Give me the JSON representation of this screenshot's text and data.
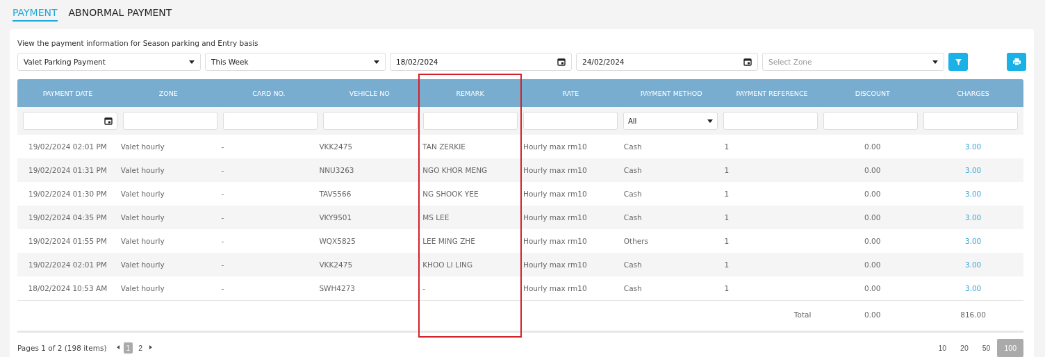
{
  "tabs": [
    {
      "label": "PAYMENT",
      "selected": true
    },
    {
      "label": "ABNORMAL PAYMENT",
      "selected": false
    }
  ],
  "description": "View the payment information for Season parking and Entry basis",
  "filters": [
    {
      "kind": "select",
      "value": "Valet Parking Payment"
    },
    {
      "kind": "select",
      "value": "This Week"
    },
    {
      "kind": "date",
      "value": "18/02/2024"
    },
    {
      "kind": "date",
      "value": "24/02/2024"
    },
    {
      "kind": "select",
      "placeholder": "Select Zone"
    }
  ],
  "table": {
    "columns": [
      {
        "label": "PAYMENT DATE",
        "highlighted": false
      },
      {
        "label": "ZONE",
        "highlighted": false
      },
      {
        "label": "CARD NO.",
        "highlighted": false
      },
      {
        "label": "VEHICLE NO",
        "highlighted": false
      },
      {
        "label": "REMARK",
        "highlighted": true
      },
      {
        "label": "RATE",
        "highlighted": false
      },
      {
        "label": "PAYMENT METHOD",
        "highlighted": false
      },
      {
        "label": "PAYMENT REFERENCE",
        "highlighted": false
      },
      {
        "label": "DISCOUNT",
        "highlighted": false
      },
      {
        "label": "CHARGES",
        "highlighted": false
      }
    ],
    "column_filters": [
      {
        "kind": "date"
      },
      {
        "kind": "text"
      },
      {
        "kind": "text"
      },
      {
        "kind": "text"
      },
      {
        "kind": "text"
      },
      {
        "kind": "text"
      },
      {
        "kind": "select",
        "value": "All"
      },
      {
        "kind": "text"
      },
      {
        "kind": "text"
      },
      {
        "kind": "text"
      }
    ],
    "rows": [
      [
        "19/02/2024 02:01 PM",
        "Valet hourly",
        "-",
        "VKK2475",
        "TAN ZERKIE",
        "Hourly max rm10",
        "Cash",
        "1",
        "0.00",
        "3.00"
      ],
      [
        "19/02/2024 01:31 PM",
        "Valet hourly",
        "-",
        "NNU3263",
        "NGO KHOR MENG",
        "Hourly max rm10",
        "Cash",
        "1",
        "0.00",
        "3.00"
      ],
      [
        "19/02/2024 01:30 PM",
        "Valet hourly",
        "-",
        "TAV5566",
        "NG SHOOK YEE",
        "Hourly max rm10",
        "Cash",
        "1",
        "0.00",
        "3.00"
      ],
      [
        "19/02/2024 04:35 PM",
        "Valet hourly",
        "-",
        "VKY9501",
        "MS LEE",
        "Hourly max rm10",
        "Cash",
        "1",
        "0.00",
        "3.00"
      ],
      [
        "19/02/2024 01:55 PM",
        "Valet hourly",
        "-",
        "WQX5825",
        "LEE MING ZHE",
        "Hourly max rm10",
        "Others",
        "1",
        "0.00",
        "3.00"
      ],
      [
        "19/02/2024 02:01 PM",
        "Valet hourly",
        "-",
        "VKK2475",
        "KHOO LI LING",
        "Hourly max rm10",
        "Cash",
        "1",
        "0.00",
        "3.00"
      ],
      [
        "18/02/2024 10:53 AM",
        "Valet hourly",
        "-",
        "SWH4273",
        "-",
        "Hourly max rm10",
        "Cash",
        "1",
        "0.00",
        "3.00"
      ]
    ],
    "totals": {
      "label": "Total",
      "discount": "0.00",
      "charges": "816.00"
    }
  },
  "pagination": {
    "summary": "Pages 1 of 2 (198 items)",
    "pages": [
      {
        "label": "1",
        "selected": true
      },
      {
        "label": "2",
        "selected": false
      }
    ],
    "page_sizes": [
      {
        "label": "10",
        "selected": false
      },
      {
        "label": "20",
        "selected": false
      },
      {
        "label": "50",
        "selected": false
      },
      {
        "label": "100",
        "selected": true
      }
    ]
  }
}
